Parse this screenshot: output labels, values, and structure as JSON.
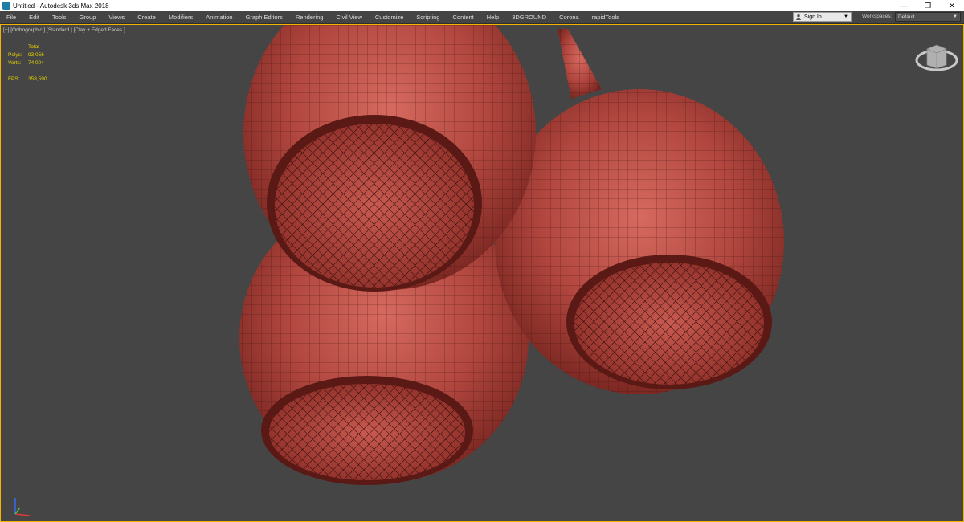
{
  "window": {
    "title": "Untitled - Autodesk 3ds Max 2018",
    "minimize": "—",
    "restore": "❐",
    "close": "✕"
  },
  "menu": [
    "File",
    "Edit",
    "Tools",
    "Group",
    "Views",
    "Create",
    "Modifiers",
    "Animation",
    "Graph Editors",
    "Rendering",
    "Civil View",
    "Customize",
    "Scripting",
    "Content",
    "Help",
    "3DGROUND",
    "Corona",
    "rapidTools"
  ],
  "account": {
    "sign_in": "Sign In",
    "workspaces_label": "Workspaces:",
    "workspace_value": "Default"
  },
  "viewport": {
    "label": "[+] [Orthographic ] [Standard ] [Clay + Edged Faces ]",
    "stats": {
      "total_label": "Total",
      "polys_label": "Polys:",
      "polys_value": "93 056",
      "verts_label": "Verts:",
      "verts_value": "74 004",
      "fps_label": "FPS:",
      "fps_value": "358,590"
    }
  },
  "colors": {
    "viewport_bg": "#454545",
    "clay": "#b0463e",
    "stats_text": "#e8d200",
    "active_border": "#f2b400"
  },
  "icons": [
    "app-icon",
    "user-icon",
    "chevron-down-icon",
    "viewcube-icon",
    "axis-tripod-icon"
  ]
}
